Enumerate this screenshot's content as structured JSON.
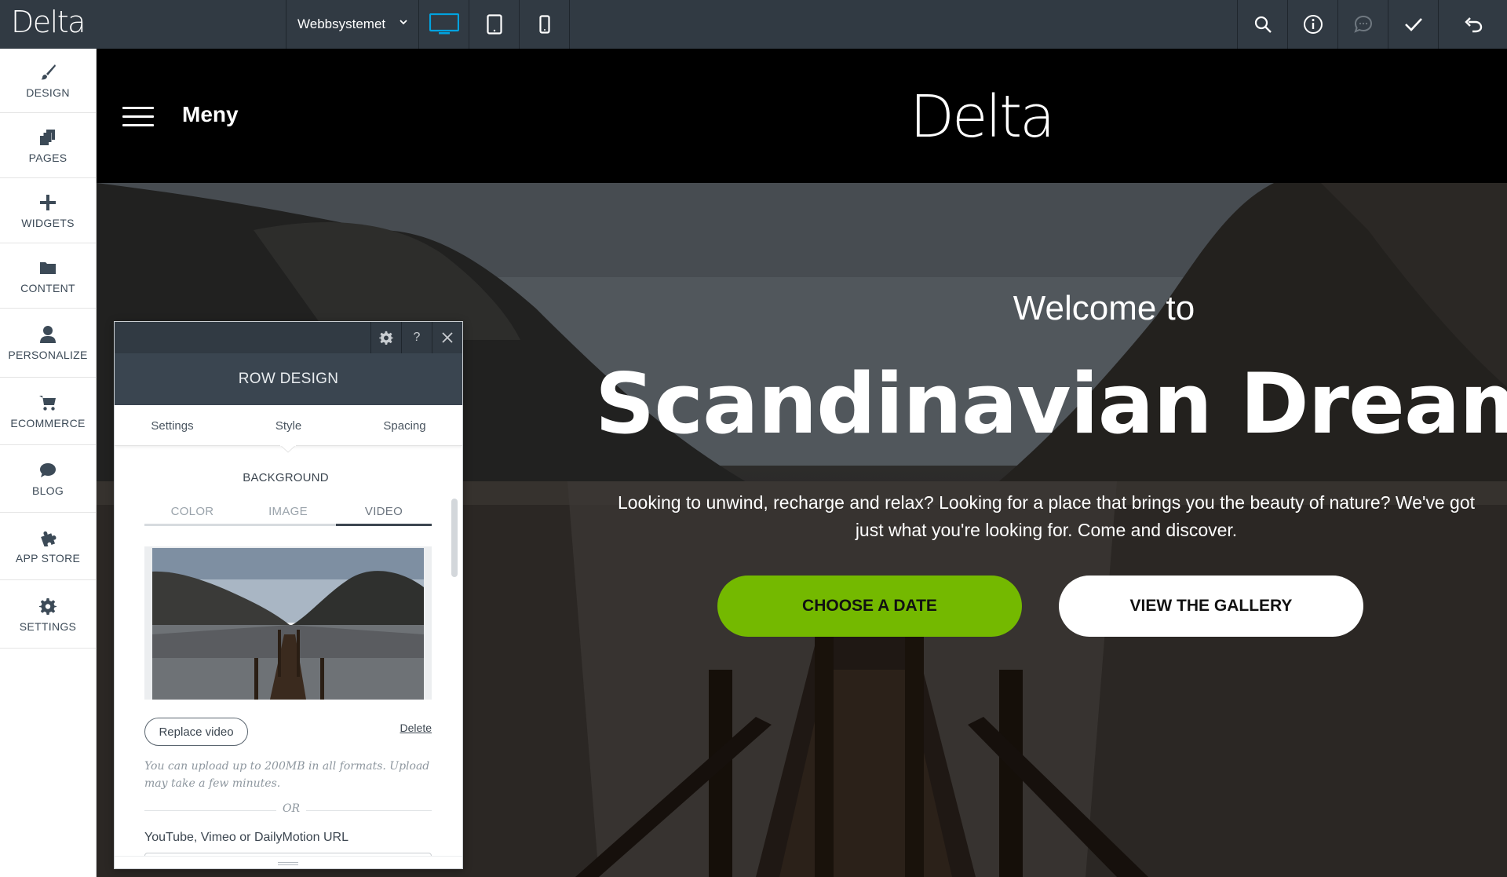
{
  "topbar": {
    "logo": "Delta",
    "site_selector": "Webbsystemet",
    "devices": [
      "desktop-icon",
      "tablet-icon",
      "mobile-icon"
    ],
    "active_device": "desktop",
    "actions": [
      "search-icon",
      "info-icon",
      "comment-icon",
      "check-icon",
      "undo-icon"
    ],
    "accent": "#00a3e0"
  },
  "sidebar": {
    "items": [
      {
        "label": "DESIGN",
        "icon": "brush-icon"
      },
      {
        "label": "PAGES",
        "icon": "pages-icon"
      },
      {
        "label": "WIDGETS",
        "icon": "plus-icon"
      },
      {
        "label": "CONTENT",
        "icon": "folder-icon"
      },
      {
        "label": "PERSONALIZE",
        "icon": "person-icon"
      },
      {
        "label": "ECOMMERCE",
        "icon": "cart-icon"
      },
      {
        "label": "BLOG",
        "icon": "speech-bubble-icon"
      },
      {
        "label": "APP STORE",
        "icon": "puzzle-icon"
      },
      {
        "label": "SETTINGS",
        "icon": "gear-icon"
      }
    ]
  },
  "site": {
    "menu_label": "Meny",
    "logo": "Delta",
    "hero": {
      "welcome": "Welcome to",
      "title": "Scandinavian Dream",
      "description": "Looking to unwind, recharge and relax? Looking for a place that brings you the beauty of nature? We've got just what you're looking for. Come and discover.",
      "primary_button": "CHOOSE A DATE",
      "secondary_button": "VIEW THE GALLERY",
      "primary_color": "#74b900"
    }
  },
  "panel": {
    "title": "ROW DESIGN",
    "tabs": [
      "Settings",
      "Style",
      "Spacing"
    ],
    "active_tab": "Spacing",
    "section_label": "BACKGROUND",
    "bg_tabs": [
      "COLOR",
      "IMAGE",
      "VIDEO"
    ],
    "active_bg_tab": "VIDEO",
    "replace_label": "Replace video",
    "delete_label": "Delete",
    "hint": "You can upload up to 200MB in all formats. Upload may take a few minutes.",
    "or_label": "OR",
    "url_label": "YouTube, Vimeo or DailyMotion URL",
    "help_label": "?"
  }
}
